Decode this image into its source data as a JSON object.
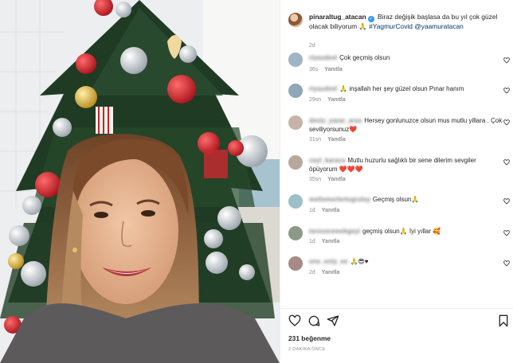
{
  "post": {
    "username": "pinaraltug_atacan",
    "caption": "Biraz değişik başlasa da bu yıl çok güzel olacak biliyorum",
    "caption_emoji": "🙏",
    "hashtag": "#YagmurCovid",
    "mention": "@yaamuratacan",
    "time": "2d"
  },
  "comments": [
    {
      "username": "riyaudeel",
      "text": "Çok geçmiş olsun",
      "time": "36s",
      "reply": "Yanıtla"
    },
    {
      "username": "riyaudeel",
      "text": "🙏 inşallah her şey güzel olsun Pınar hanım",
      "time": "29sn",
      "reply": "Yanıtla"
    },
    {
      "username": "deniz_yazar_aras",
      "text": "Hersey gonlunuzce olsun mus mutlu yillara . Çok seviliyorsunuz❤️",
      "time": "31sn",
      "reply": "Yanıtla"
    },
    {
      "username": "ceyl_karaca",
      "text": "Mutlu huzurlu sağlıklı bir sene dilerim sevgiler öpüyorum ❤️❤️❤️",
      "time": "35sn",
      "reply": "Yanıtla"
    },
    {
      "username": "meltemerlertugrulay",
      "text": "Geçmiş olsun🙏",
      "time": "1d",
      "reply": "Yanıtla"
    },
    {
      "username": "toroseremekgeyi",
      "text": "geçmiş olsun🙏 İyi yıllar 🥰",
      "time": "1d",
      "reply": "Yanıtla"
    },
    {
      "username": "one_only_ee",
      "text": "🙏😎♥",
      "time": "2d",
      "reply": "Yanıtla"
    }
  ],
  "footer": {
    "likes": "231 beğenme",
    "ago": "2 DAKİKA ÖNCE"
  },
  "icons": {
    "like": "heart-icon",
    "comment": "comment-icon",
    "share": "paper-plane-icon",
    "save": "bookmark-icon"
  },
  "colors": {
    "verified": "#3897f0",
    "link": "#00376b",
    "muted": "#8e8e8e"
  }
}
